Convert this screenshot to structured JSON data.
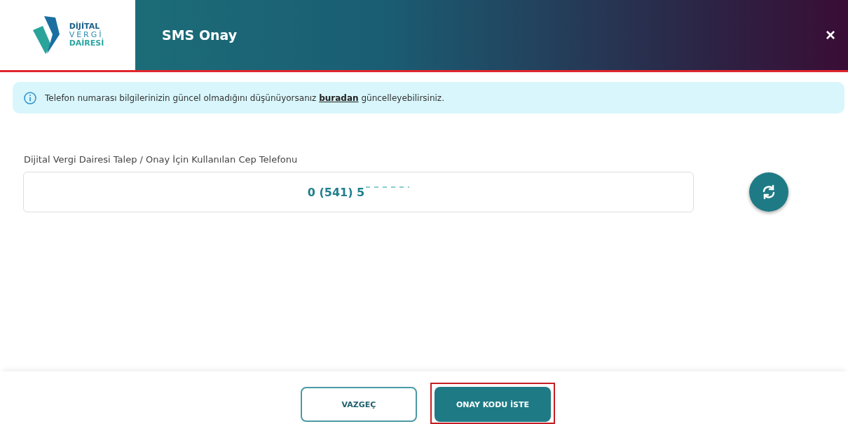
{
  "logo": {
    "lines": [
      "DİJİTAL",
      "VERGİ",
      "DAİRESİ"
    ]
  },
  "header": {
    "title": "SMS Onay",
    "close": "×"
  },
  "info": {
    "before": "Telefon numarası bilgilerinizin güncel olmadığını düşünüyorsanız",
    "link": "buradan",
    "after": "güncelleyebilirsiniz."
  },
  "phone": {
    "label": "Dijital Vergi Dairesi Talep / Onay İçin Kullanılan Cep Telefonu",
    "value": "0 (541) 5"
  },
  "buttons": [
    {
      "label": "VAZGEÇ",
      "kind": "secondary",
      "highlighted": false
    },
    {
      "label": "ONAY KODU İSTE",
      "kind": "primary",
      "highlighted": true
    }
  ]
}
